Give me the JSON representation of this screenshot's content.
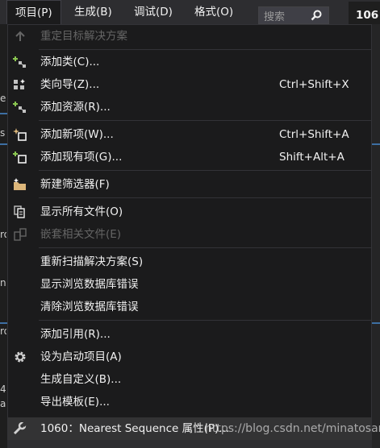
{
  "menubar": {
    "items": [
      "项目(P)",
      "生成(B)",
      "调试(D)",
      "格式(O)"
    ],
    "search_placeholder": "搜索",
    "version_text": "106"
  },
  "background": {
    "left_fragments": [
      "e",
      "s",
      "ro",
      "n",
      "ro",
      "4",
      "a"
    ]
  },
  "menu": {
    "items": [
      {
        "label": "重定目标解决方案",
        "shortcut": "",
        "icon": "arrow-up-icon",
        "disabled": true
      },
      {
        "label": "添加类(C)...",
        "shortcut": "",
        "icon": "add-class-icon",
        "disabled": false
      },
      {
        "label": "类向导(Z)...",
        "shortcut": "Ctrl+Shift+X",
        "icon": "class-wizard-icon",
        "disabled": false
      },
      {
        "label": "添加资源(R)...",
        "shortcut": "",
        "icon": "add-resource-icon",
        "disabled": false
      },
      {
        "label": "添加新项(W)...",
        "shortcut": "Ctrl+Shift+A",
        "icon": "add-new-item-icon",
        "disabled": false
      },
      {
        "label": "添加现有项(G)...",
        "shortcut": "Shift+Alt+A",
        "icon": "add-existing-item-icon",
        "disabled": false
      },
      {
        "label": "新建筛选器(F)",
        "shortcut": "",
        "icon": "new-filter-icon",
        "disabled": false
      },
      {
        "label": "显示所有文件(O)",
        "shortcut": "",
        "icon": "show-all-files-icon",
        "disabled": false
      },
      {
        "label": "嵌套相关文件(E)",
        "shortcut": "",
        "icon": "nest-files-icon",
        "disabled": true
      },
      {
        "label": "重新扫描解决方案(S)",
        "shortcut": "",
        "icon": "",
        "disabled": false
      },
      {
        "label": "显示浏览数据库错误",
        "shortcut": "",
        "icon": "",
        "disabled": false
      },
      {
        "label": "清除浏览数据库错误",
        "shortcut": "",
        "icon": "",
        "disabled": false
      },
      {
        "label": "添加引用(R)...",
        "shortcut": "",
        "icon": "",
        "disabled": false
      },
      {
        "label": "设为启动项目(A)",
        "shortcut": "",
        "icon": "gear-icon",
        "disabled": false
      },
      {
        "label": "生成自定义(B)...",
        "shortcut": "",
        "icon": "",
        "disabled": false
      },
      {
        "label": "导出模板(E)...",
        "shortcut": "",
        "icon": "",
        "disabled": false
      },
      {
        "label": "1060：Nearest Sequence 属性(P)...",
        "shortcut": "",
        "icon": "wrench-icon",
        "disabled": false
      }
    ]
  },
  "watermark": "https://blog.csdn.net/minatosan",
  "colors": {
    "menu_bg": "#1b1b1c",
    "text": "#f1f1f1",
    "disabled_text": "#656565",
    "hover_bg": "#333334",
    "separator": "#333337",
    "icon_green": "#8ac650",
    "icon_blue": "#c2c2c2",
    "folder_yellow": "#dcb67a"
  }
}
